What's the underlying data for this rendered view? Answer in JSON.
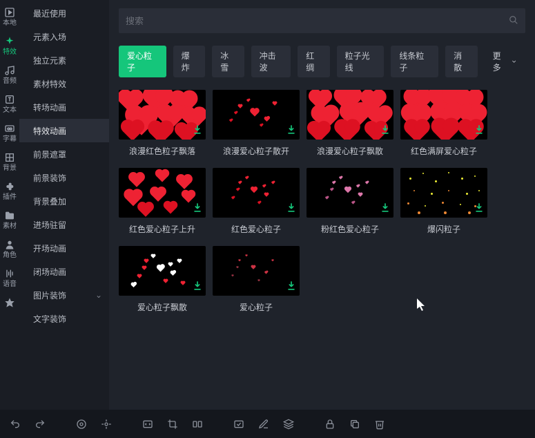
{
  "rail": [
    {
      "label": "本地",
      "icon": "film-icon"
    },
    {
      "label": "特效",
      "icon": "sparkle-icon",
      "active": true
    },
    {
      "label": "音频",
      "icon": "music-icon"
    },
    {
      "label": "文本",
      "icon": "text-icon"
    },
    {
      "label": "字幕",
      "icon": "cc-icon"
    },
    {
      "label": "背景",
      "icon": "grid-icon"
    },
    {
      "label": "插件",
      "icon": "plugin-icon"
    },
    {
      "label": "素材",
      "icon": "folder-icon"
    },
    {
      "label": "角色",
      "icon": "person-icon"
    },
    {
      "label": "语音",
      "icon": "mic-icon"
    },
    {
      "label": "",
      "icon": "star-icon"
    }
  ],
  "side": [
    {
      "label": "最近使用"
    },
    {
      "label": "元素入场"
    },
    {
      "label": "独立元素"
    },
    {
      "label": "素材特效"
    },
    {
      "label": "转场动画"
    },
    {
      "label": "特效动画",
      "active": true
    },
    {
      "label": "前景遮罩"
    },
    {
      "label": "前景装饰"
    },
    {
      "label": "背景叠加"
    },
    {
      "label": "进场驻留"
    },
    {
      "label": "开场动画"
    },
    {
      "label": "闭场动画"
    },
    {
      "label": "图片装饰",
      "expandable": true
    },
    {
      "label": "文字装饰"
    }
  ],
  "search": {
    "placeholder": "搜索"
  },
  "tags": [
    {
      "label": "爱心粒子",
      "active": true
    },
    {
      "label": "爆炸"
    },
    {
      "label": "冰雪"
    },
    {
      "label": "冲击波"
    },
    {
      "label": "红绸"
    },
    {
      "label": "粒子光线"
    },
    {
      "label": "线条粒子"
    },
    {
      "label": "消散"
    }
  ],
  "more_label": "更多",
  "items": [
    {
      "label": "浪漫红色粒子飘落",
      "style": "red-dense"
    },
    {
      "label": "浪漫爱心粒子散开",
      "style": "red-sparse"
    },
    {
      "label": "浪漫爱心粒子飘散",
      "style": "red-dense2"
    },
    {
      "label": "红色满屏爱心粒子",
      "style": "red-full"
    },
    {
      "label": "红色爱心粒子上升",
      "style": "red-float"
    },
    {
      "label": "红色爱心粒子",
      "style": "red-small"
    },
    {
      "label": "粉红色爱心粒子",
      "style": "pink-small"
    },
    {
      "label": "爆闪粒子",
      "style": "spark"
    },
    {
      "label": "爱心粒子飘散",
      "style": "white-mix"
    },
    {
      "label": "爱心粒子",
      "style": "tiny"
    }
  ]
}
